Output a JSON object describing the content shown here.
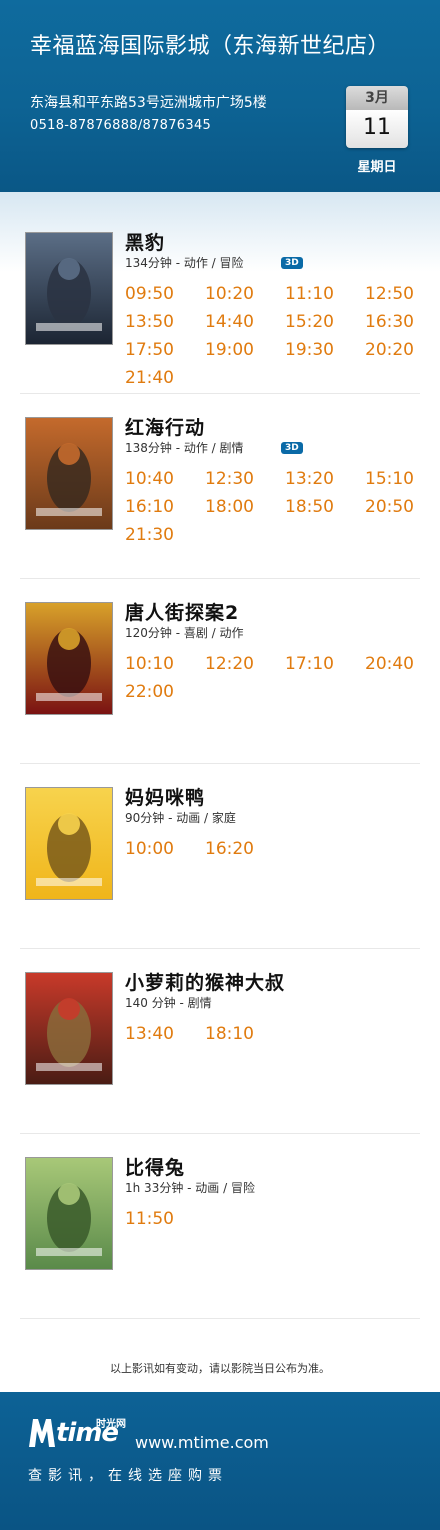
{
  "header": {
    "cinema_name": "幸福蓝海国际影城（东海新世纪店）",
    "address": "东海县和平东路53号远洲城市广场5楼",
    "phone": "0518-87876888/87876345",
    "date": {
      "month": "3月",
      "day": "11",
      "weekday": "星期日"
    }
  },
  "movies": [
    {
      "title": "黑豹",
      "meta": "134分钟 - 动作 / 冒险",
      "badge": "3D",
      "times": [
        "09:50",
        "10:20",
        "11:10",
        "12:50",
        "13:50",
        "14:40",
        "15:20",
        "16:30",
        "17:50",
        "19:00",
        "19:30",
        "20:20",
        "21:40"
      ]
    },
    {
      "title": "红海行动",
      "meta": "138分钟 - 动作 / 剧情",
      "badge": "3D",
      "times": [
        "10:40",
        "12:30",
        "13:20",
        "15:10",
        "16:10",
        "18:00",
        "18:50",
        "20:50",
        "21:30"
      ]
    },
    {
      "title": "唐人街探案2",
      "meta": "120分钟 - 喜剧 / 动作",
      "badge": "",
      "times": [
        "10:10",
        "12:20",
        "17:10",
        "20:40",
        "22:00"
      ]
    },
    {
      "title": "妈妈咪鸭",
      "meta": "90分钟 - 动画 / 家庭",
      "badge": "",
      "times": [
        "10:00",
        "16:20"
      ]
    },
    {
      "title": "小萝莉的猴神大叔",
      "meta": "140 分钟 - 剧情",
      "badge": "",
      "times": [
        "13:40",
        "18:10"
      ]
    },
    {
      "title": "比得兔",
      "meta": "1h 33分钟 - 动画 / 冒险",
      "badge": "",
      "times": [
        "11:50"
      ]
    }
  ],
  "notice": "以上影讯如有变动，请以影院当日公布为准。",
  "footer": {
    "logo_text": "time",
    "logo_cn": "时光网",
    "website": "www.mtime.com",
    "slogan": "查影讯，在线选座购票"
  },
  "colors": {
    "header_blue": "#0d6394",
    "time_orange": "#e07b0f",
    "badge_blue": "#0a6aa7"
  }
}
